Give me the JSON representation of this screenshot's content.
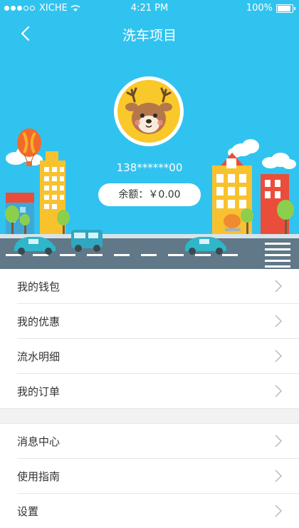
{
  "status_bar": {
    "carrier": "XICHE",
    "time": "4:21 PM",
    "battery": "100%"
  },
  "nav": {
    "title": "洗车项目",
    "back_icon": "chevron-left-icon"
  },
  "profile": {
    "avatar_icon": "deer-avatar-icon",
    "phone": "138******00",
    "balance_label": "余额：",
    "balance_value": "￥0.00"
  },
  "menu_group_1": [
    {
      "label": "我的钱包"
    },
    {
      "label": "我的优惠"
    },
    {
      "label": "流水明细"
    },
    {
      "label": "我的订单"
    }
  ],
  "menu_group_2": [
    {
      "label": "消息中心"
    },
    {
      "label": "使用指南"
    },
    {
      "label": "设置"
    }
  ],
  "colors": {
    "header_bg": "#31c3ef",
    "road": "#607888",
    "page_bg": "#f2f2f2"
  }
}
